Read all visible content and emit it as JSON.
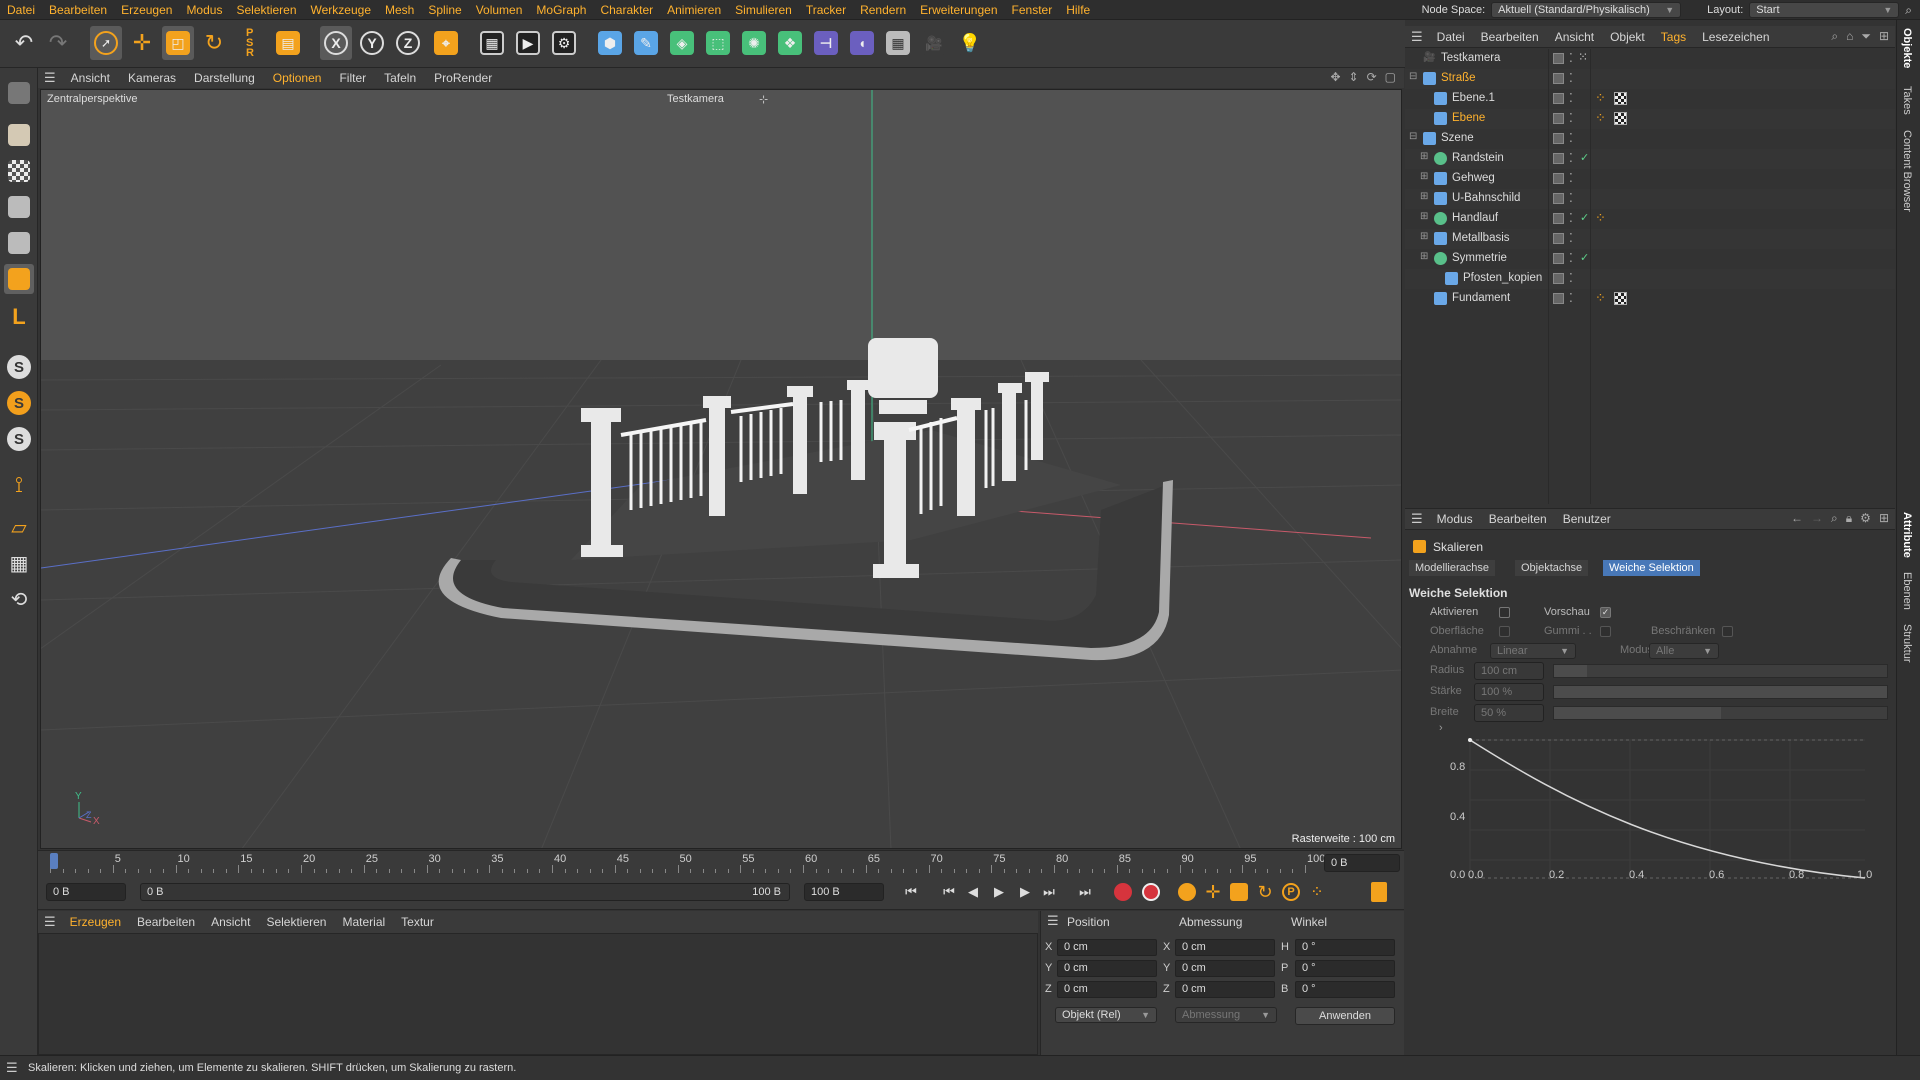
{
  "menubar": {
    "items": [
      "Datei",
      "Bearbeiten",
      "Erzeugen",
      "Modus",
      "Selektieren",
      "Werkzeuge",
      "Mesh",
      "Spline",
      "Volumen",
      "MoGraph",
      "Charakter",
      "Animieren",
      "Simulieren",
      "Tracker",
      "Rendern",
      "Erweiterungen",
      "Fenster",
      "Hilfe"
    ],
    "node_space_label": "Node Space:",
    "node_space_value": "Aktuell (Standard/Physikalisch)",
    "layout_label": "Layout:",
    "layout_value": "Start"
  },
  "viewport": {
    "menu": [
      "Ansicht",
      "Kameras",
      "Darstellung",
      "Optionen",
      "Filter",
      "Tafeln",
      "ProRender"
    ],
    "perspective_label": "Zentralperspektive",
    "camera_label": "Testkamera",
    "grid_label": "Rasterweite : 100 cm"
  },
  "timeline": {
    "ticks": [
      "0",
      "5",
      "10",
      "15",
      "20",
      "25",
      "30",
      "35",
      "40",
      "45",
      "50",
      "55",
      "60",
      "65",
      "70",
      "75",
      "80",
      "85",
      "90",
      "95",
      "100"
    ],
    "current_frame": "0 B",
    "start_frame": "0 B",
    "range_start": "0 B",
    "range_end": "100 B",
    "end_frame": "100 B"
  },
  "material_manager": {
    "menu": [
      "Erzeugen",
      "Bearbeiten",
      "Ansicht",
      "Selektieren",
      "Material",
      "Textur"
    ]
  },
  "coord_manager": {
    "headers": [
      "Position",
      "Abmessung",
      "Winkel"
    ],
    "pos": {
      "x": "0 cm",
      "y": "0 cm",
      "z": "0 cm"
    },
    "size": {
      "x": "0 cm",
      "y": "0 cm",
      "z": "0 cm"
    },
    "rot": {
      "h": "0 °",
      "p": "0 °",
      "b": "0 °"
    },
    "axis_labels": {
      "x": "X",
      "y": "Y",
      "z": "Z",
      "h": "H",
      "p": "P",
      "b": "B"
    },
    "mode_value": "Objekt (Rel)",
    "size_mode_value": "Abmessung",
    "apply_label": "Anwenden"
  },
  "object_manager": {
    "menu": [
      "Datei",
      "Bearbeiten",
      "Ansicht",
      "Objekt",
      "Tags",
      "Lesezeichen"
    ],
    "objects": [
      {
        "name": "Testkamera",
        "indent": 0,
        "icon": "camera",
        "color": "#cfcfcf"
      },
      {
        "name": "Straße",
        "indent": 0,
        "icon": "null",
        "color": "#6aa8e8",
        "highlight": true
      },
      {
        "name": "Ebene.1",
        "indent": 1,
        "icon": "plane",
        "color": "#6aa8e8"
      },
      {
        "name": "Ebene",
        "indent": 1,
        "icon": "plane",
        "color": "#6aa8e8",
        "highlight": true
      },
      {
        "name": "Szene",
        "indent": 0,
        "icon": "null",
        "color": "#6aa8e8"
      },
      {
        "name": "Randstein",
        "indent": 1,
        "icon": "sweep",
        "color": "#59c08a"
      },
      {
        "name": "Gehweg",
        "indent": 1,
        "icon": "null",
        "color": "#6aa8e8"
      },
      {
        "name": "U-Bahnschild",
        "indent": 1,
        "icon": "null",
        "color": "#6aa8e8"
      },
      {
        "name": "Handlauf",
        "indent": 1,
        "icon": "sweep",
        "color": "#59c08a"
      },
      {
        "name": "Metallbasis",
        "indent": 1,
        "icon": "null",
        "color": "#6aa8e8"
      },
      {
        "name": "Symmetrie",
        "indent": 1,
        "icon": "symmetry",
        "color": "#59c08a"
      },
      {
        "name": "Pfosten_kopien",
        "indent": 2,
        "icon": "null",
        "color": "#6aa8e8"
      },
      {
        "name": "Fundament",
        "indent": 1,
        "icon": "plane",
        "color": "#6aa8e8"
      }
    ]
  },
  "attribute_manager": {
    "menu": [
      "Modus",
      "Bearbeiten",
      "Benutzer"
    ],
    "tool_name": "Skalieren",
    "tabs": [
      "Modellierachse",
      "Objektachse",
      "Weiche Selektion"
    ],
    "section_title": "Weiche Selektion",
    "labels": {
      "aktivieren": "Aktivieren",
      "vorschau": "Vorschau",
      "oberflaeche": "Oberfläche",
      "gummi": "Gummi . .",
      "beschraenken": "Beschränken",
      "abnahme": "Abnahme",
      "modus": "Modus",
      "radius": "Radius",
      "staerke": "Stärke",
      "breite": "Breite"
    },
    "abnahme_value": "Linear",
    "modus_value": "Alle",
    "radius_value": "100 cm",
    "staerke_value": "100 %",
    "breite_value": "50 %",
    "staerke_fraction": 1.0,
    "breite_fraction": 0.5,
    "radius_fraction": 0.1
  },
  "curve": {
    "y_ticks": [
      "0.8",
      "0.4",
      "0.0"
    ],
    "x_ticks": [
      "0.2",
      "0.4",
      "0.6",
      "0.8",
      "1.0"
    ]
  },
  "right_tabs": [
    "Objekte",
    "Takes",
    "Content Browser",
    "Attribute",
    "Ebenen",
    "Struktur"
  ],
  "status_text": "Skalieren: Klicken und ziehen, um Elemente zu skalieren. SHIFT drücken, um Skalierung zu rastern."
}
